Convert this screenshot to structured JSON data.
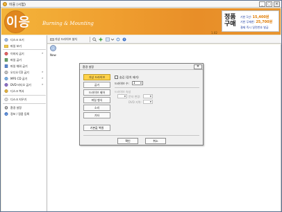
{
  "window": {
    "title": "이응 (시험)",
    "controls": [
      "_",
      "□",
      "×"
    ]
  },
  "banner": {
    "logo": "이응",
    "subtitle": "Burning & Mounting",
    "version": "1.02",
    "register": {
      "big": "정품구매",
      "line1_label": "기한 1년:",
      "line1_value": "15,400원",
      "line2_label": "기한 무제한:",
      "line2_value": "25,700원",
      "line3": "결제 즉시 일련번호 발급"
    },
    "colors": {
      "accent": "#f0a030",
      "price": "#e07a00",
      "link": "#1a3aa0"
    }
  },
  "sidebar": {
    "items": [
      {
        "label": "디스크 조기",
        "icon": "disc-eject-icon",
        "arrow": ""
      },
      {
        "label": "파일 보기",
        "icon": "folder-icon",
        "arrow": ""
      },
      {
        "label": "이미지 굽기",
        "icon": "image-icon",
        "arrow": "»"
      },
      {
        "label": "파일 굽기",
        "icon": "file-icon",
        "arrow": ""
      },
      {
        "label": "파일 채워 굽기",
        "icon": "file-fill-icon",
        "arrow": ""
      },
      {
        "label": "오디오 CD 굽기",
        "icon": "audio-cd-icon",
        "arrow": "»"
      },
      {
        "label": "MP3 CD 굽기",
        "icon": "mp3-icon",
        "arrow": "»"
      },
      {
        "label": "DVD 비디오 굽기",
        "icon": "dvd-icon",
        "arrow": "»"
      },
      {
        "label": "디스크 복사",
        "icon": "disc-copy-icon",
        "arrow": ""
      },
      {
        "label": "디스크 지우기",
        "icon": "disc-erase-icon",
        "arrow": ""
      },
      {
        "label": "환경 설정",
        "icon": "settings-icon",
        "arrow": ""
      },
      {
        "label": "정보 / 정품 등록",
        "icon": "info-icon",
        "arrow": ""
      }
    ]
  },
  "toolbar": {
    "add_drive_label": "가상 드라이브 설치"
  },
  "content": {
    "drive_label": "New"
  },
  "dialog": {
    "title": "환경 설정",
    "close": "×",
    "tabs": [
      "가상 드라이브",
      "굽기",
      "드라이브 제어",
      "파일 형식",
      "소리",
      "기타"
    ],
    "reset_label": "기본값 복원",
    "hide_label": "숨김 (장치 제거)",
    "drive_count_label": "드라이브 수:",
    "drive_count_value": "1",
    "drive_props_label": "드라이브 속성",
    "letter_label": "문자 변경:",
    "dvd_region_label": "DVD 지역:",
    "ok_label": "확인",
    "cancel_label": "취소"
  }
}
